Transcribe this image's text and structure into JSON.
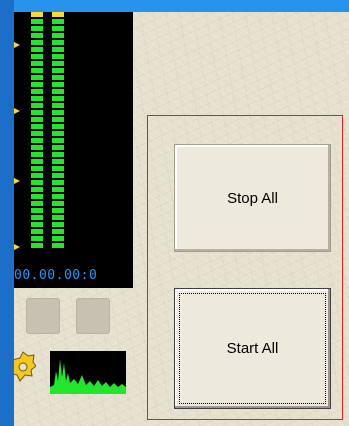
{
  "meter": {
    "timecode": "00.00.00:0"
  },
  "controls": {
    "stop_all_label": "Stop All",
    "start_all_label": "Start All"
  },
  "colors": {
    "meter_green": "#21e62b",
    "meter_yellow": "#ffd82a",
    "timecode_blue": "#1a9bff",
    "group_border": "#e02020"
  }
}
